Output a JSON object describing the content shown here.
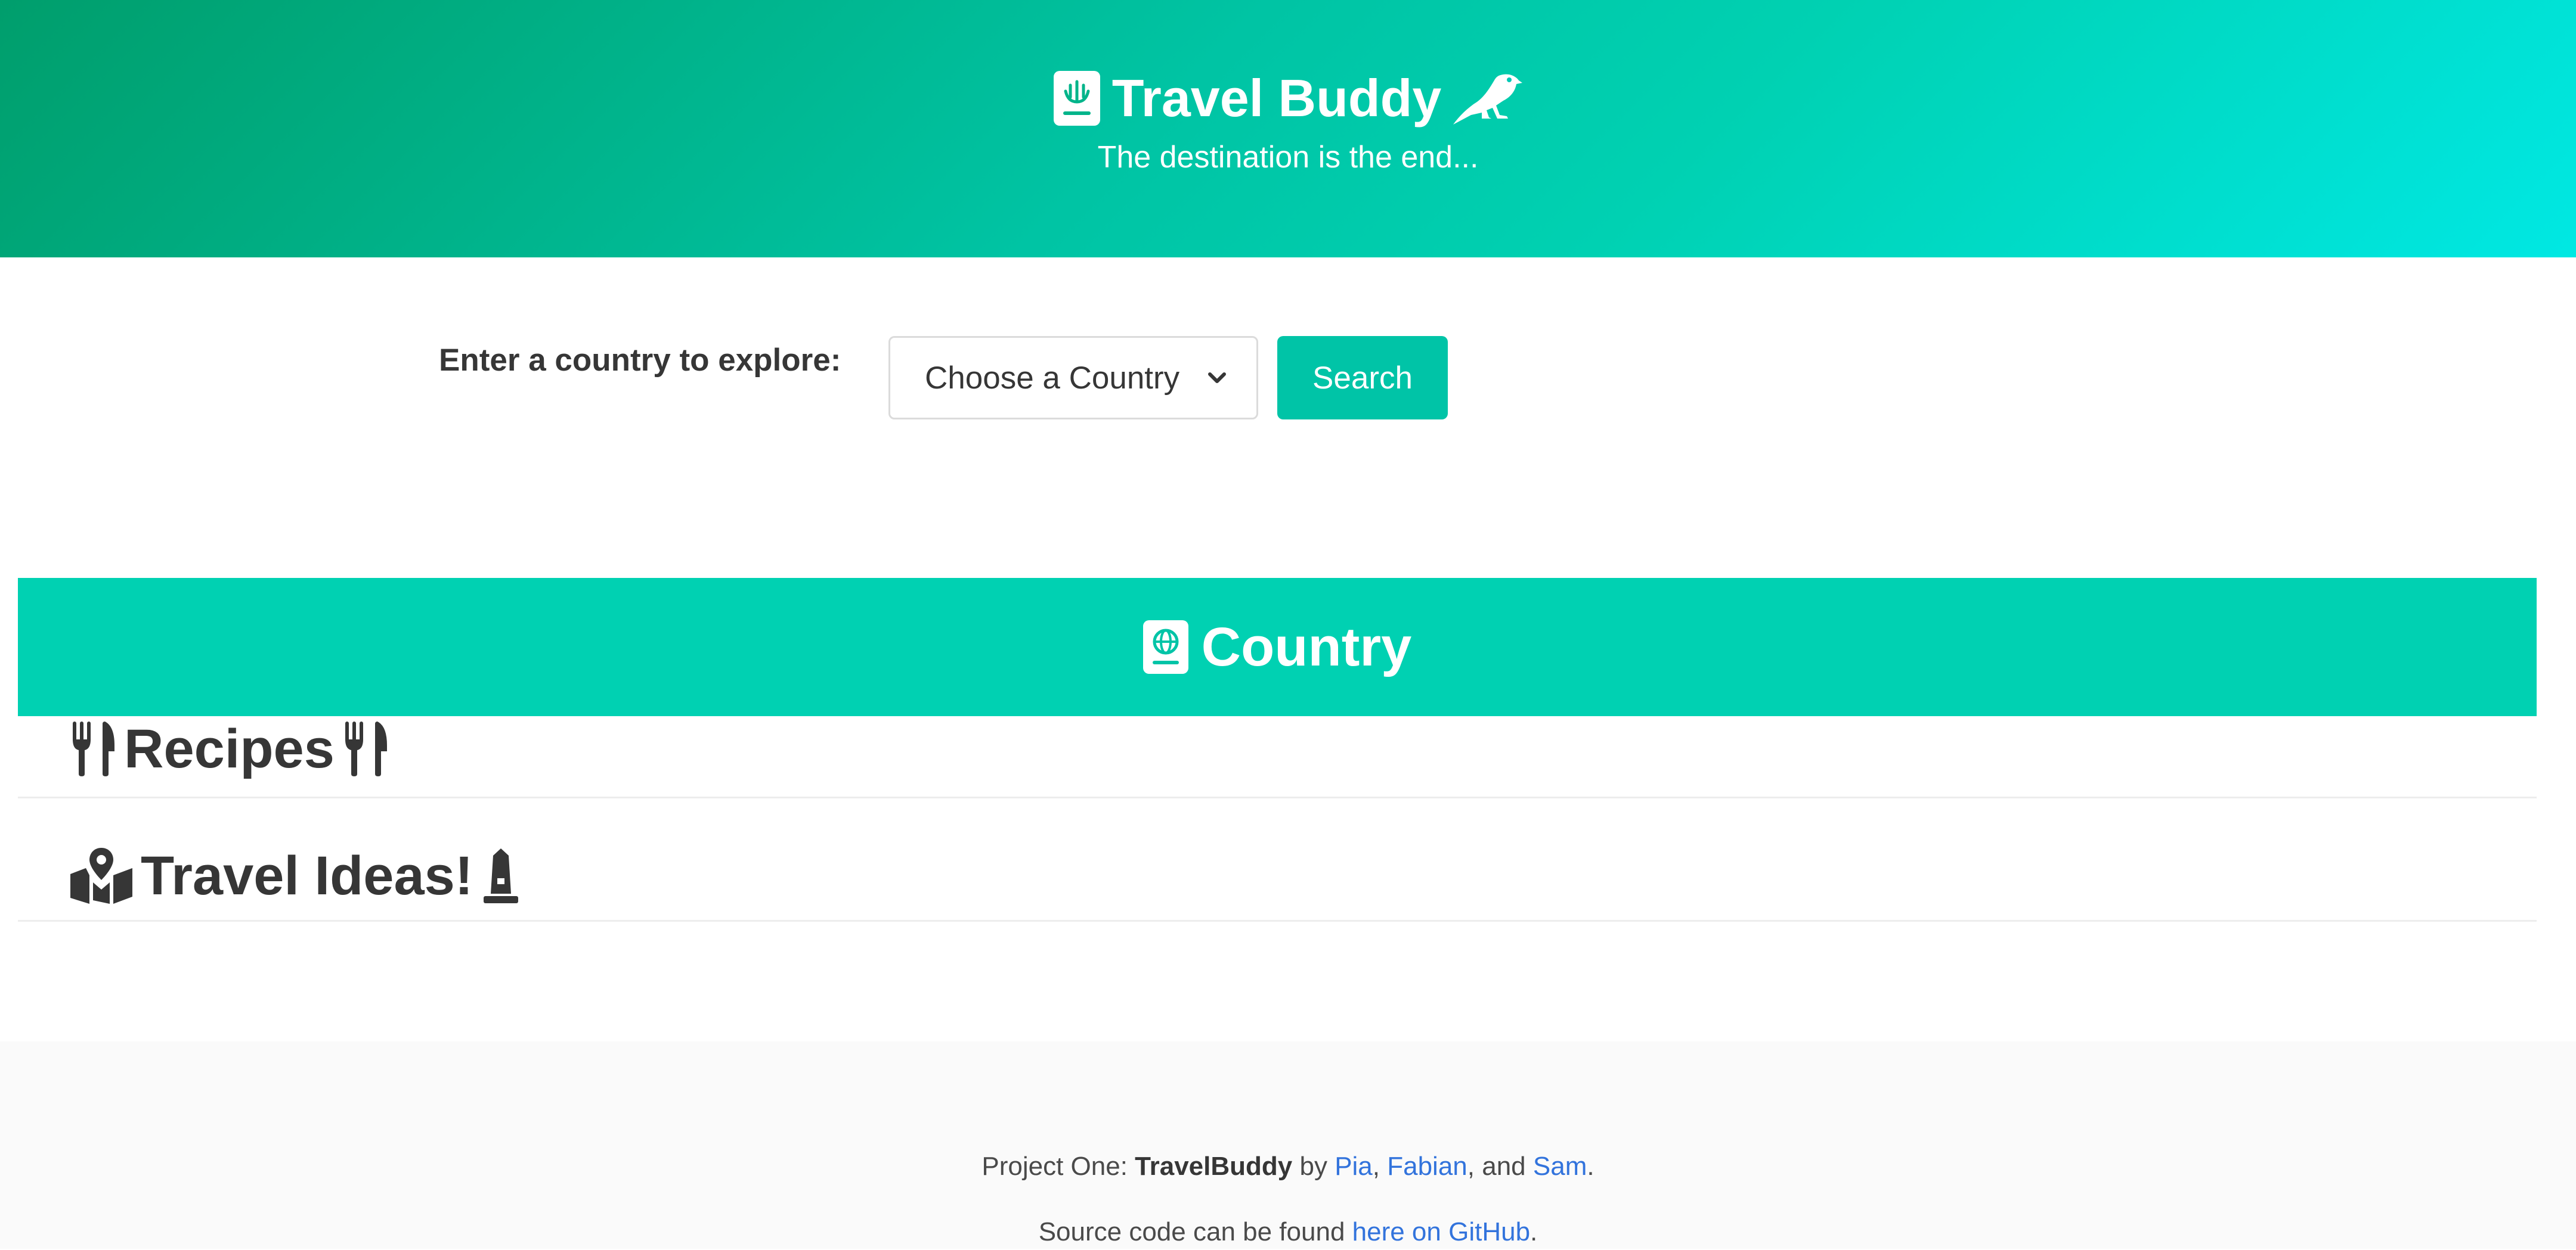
{
  "hero": {
    "title": "Travel Buddy",
    "subtitle": "The destination is the end...",
    "left_icon": "passport-icon",
    "right_icon": "crow-icon"
  },
  "search": {
    "label": "Enter a country to explore:",
    "select_value": "Choose a Country",
    "button_label": "Search"
  },
  "country_section": {
    "title": "Country",
    "icon": "passport-globe-icon"
  },
  "recipes_section": {
    "title": "Recipes",
    "icon": "utensils-icon"
  },
  "travel_section": {
    "title": "Travel Ideas!",
    "left_icon": "map-marked-icon",
    "right_icon": "monument-icon"
  },
  "footer": {
    "line1_prefix": "Project One: ",
    "project_name": "TravelBuddy",
    "by": " by ",
    "author1": "Pia",
    "sep1": ", ",
    "author2": "Fabian",
    "sep2": ", and ",
    "author3": "Sam",
    "end1": ".",
    "line2_prefix": "Source code can be found ",
    "github_link": "here on GitHub",
    "end2": "."
  },
  "colors": {
    "hero_gradient_start": "#009e6c",
    "hero_gradient_end": "#00e8e3",
    "primary": "#00d1b2",
    "button": "#00c4a7",
    "link": "#3273dc",
    "text": "#363636",
    "footer_bg": "#fafafa"
  }
}
